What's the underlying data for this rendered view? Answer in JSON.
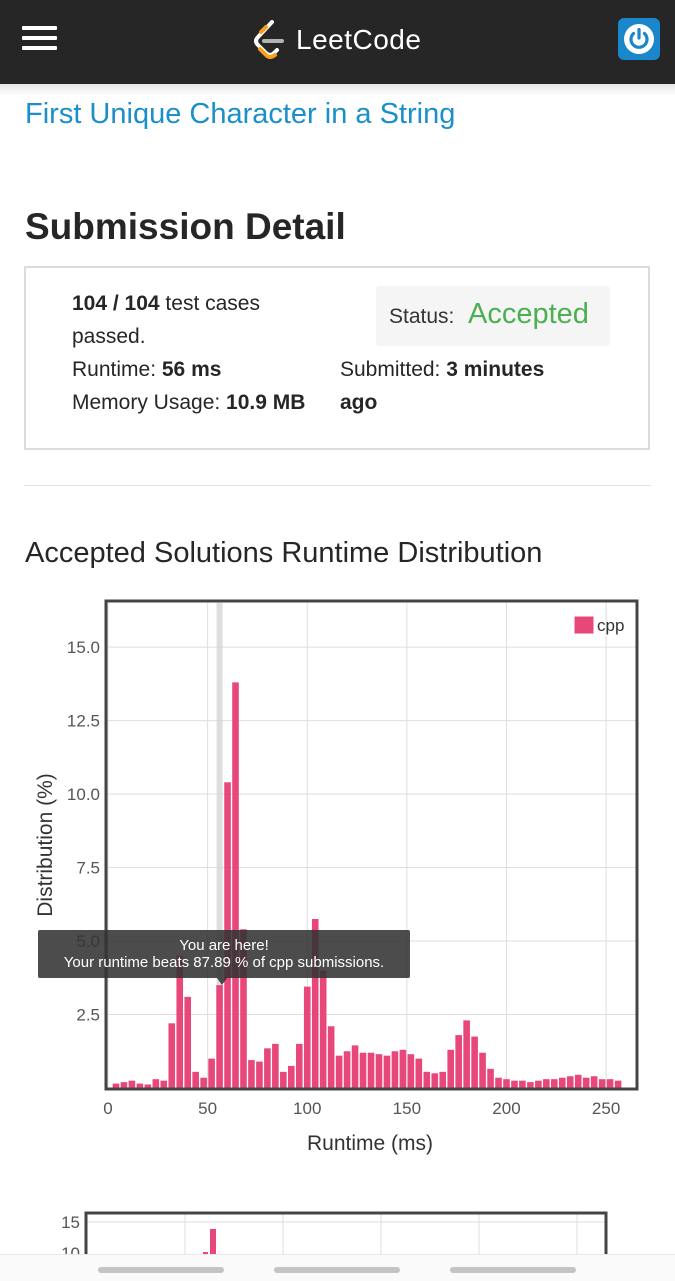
{
  "header": {
    "brand": "LeetCode",
    "colors": {
      "bar": "#262626",
      "logo_accent": "#f89f1b",
      "power_button": "#1b86c9"
    }
  },
  "problem": {
    "title": "First Unique Character in a String"
  },
  "submission": {
    "heading": "Submission Detail",
    "test_cases_count": "104 / 104",
    "test_cases_suffix": " test cases",
    "passed": "passed.",
    "runtime_label": "Runtime: ",
    "runtime_value": "56 ms",
    "memory_label": "Memory Usage: ",
    "memory_value": "10.9 MB",
    "status_label": "Status: ",
    "status_value": "Accepted",
    "submitted_label": "Submitted: ",
    "submitted_value": "3 minutes",
    "submitted_value_2": "ago",
    "colors": {
      "accepted": "#4caf50",
      "link": "#1a8fc9"
    }
  },
  "distribution": {
    "heading": "Accepted Solutions Runtime Distribution",
    "tooltip_line1": "You are here!",
    "tooltip_line2": "Your runtime beats 87.89 % of cpp submissions."
  },
  "chart_data": {
    "type": "bar",
    "xlabel": "Runtime (ms)",
    "ylabel": "Distribution (%)",
    "xlim": [
      0,
      265
    ],
    "ylim": [
      0,
      16.5
    ],
    "xticks": [
      0,
      50,
      100,
      150,
      200,
      250
    ],
    "yticks": [
      2.5,
      5.0,
      7.5,
      10.0,
      12.5,
      15.0
    ],
    "ytick_labels": [
      "2.5",
      "5.0",
      "7.5",
      "10.0",
      "12.5",
      "15.0"
    ],
    "grid": true,
    "legend": "top-right",
    "series": [
      {
        "name": "cpp",
        "color": "#e8477a",
        "x": [
          4,
          8,
          12,
          16,
          20,
          24,
          28,
          32,
          36,
          40,
          44,
          48,
          52,
          56,
          60,
          64,
          68,
          72,
          76,
          80,
          84,
          88,
          92,
          96,
          100,
          104,
          108,
          112,
          116,
          120,
          124,
          128,
          132,
          136,
          140,
          144,
          148,
          152,
          156,
          160,
          164,
          168,
          172,
          176,
          180,
          184,
          188,
          192,
          196,
          200,
          204,
          208,
          212,
          216,
          220,
          224,
          228,
          232,
          236,
          240,
          244,
          248,
          252,
          256
        ],
        "values": [
          0.15,
          0.2,
          0.25,
          0.15,
          0.12,
          0.3,
          0.25,
          2.2,
          4.5,
          3.1,
          0.55,
          0.35,
          1.0,
          3.5,
          10.4,
          13.8,
          5.4,
          0.95,
          0.9,
          1.35,
          1.5,
          0.55,
          0.75,
          1.5,
          3.45,
          5.75,
          4.0,
          2.1,
          1.1,
          1.25,
          1.45,
          1.2,
          1.2,
          1.15,
          1.1,
          1.25,
          1.3,
          1.15,
          1.0,
          0.55,
          0.5,
          0.55,
          1.3,
          1.8,
          2.3,
          1.75,
          1.2,
          0.65,
          0.35,
          0.3,
          0.25,
          0.25,
          0.2,
          0.25,
          0.3,
          0.3,
          0.35,
          0.4,
          0.45,
          0.35,
          0.4,
          0.3,
          0.3,
          0.25
        ]
      }
    ],
    "marker_x": 56
  },
  "secondary_chart": {
    "ytick_labels": [
      "15",
      "10"
    ]
  }
}
